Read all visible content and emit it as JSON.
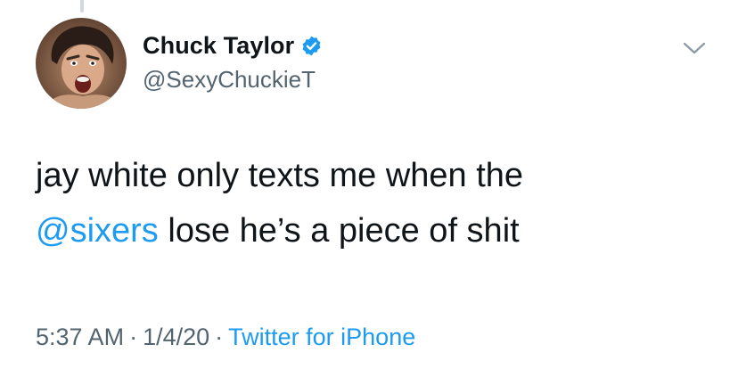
{
  "user": {
    "display_name": "Chuck Taylor",
    "handle": "@SexyChuckieT",
    "verified": true,
    "avatar_icon": "profile-photo-avatar"
  },
  "tweet": {
    "line1": "jay white only texts me when the",
    "mention": "@sixers",
    "line2_rest": " lose he’s a piece of shit"
  },
  "meta": {
    "time": "5:37 AM",
    "separator": "·",
    "date": "1/4/20",
    "source": "Twitter for iPhone"
  },
  "colors": {
    "link": "#1d9bf0",
    "secondary_text": "#536471",
    "primary_text": "#0f1419",
    "verified_badge": "#1d9bf0"
  },
  "icons": {
    "menu": "chevron-down-icon",
    "badge": "verified-badge-icon"
  }
}
